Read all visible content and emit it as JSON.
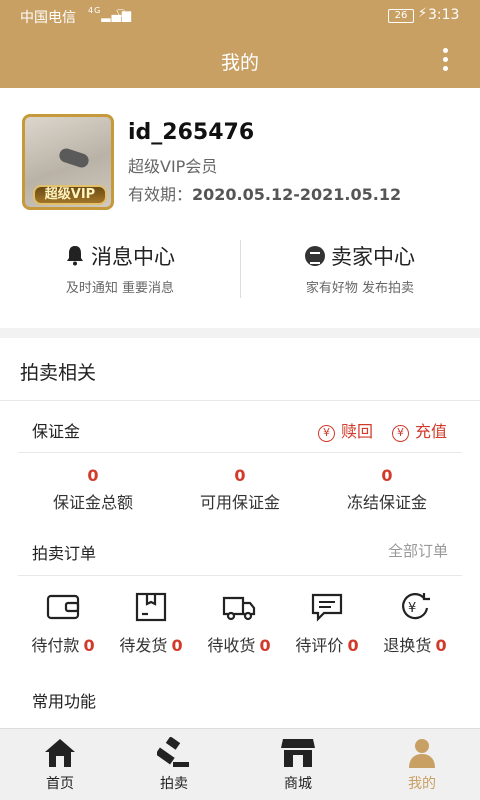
{
  "status_bar": {
    "carrier": "中国电信",
    "network": "4G",
    "battery": "26",
    "time": "3:13"
  },
  "header": {
    "title": "我的"
  },
  "profile": {
    "avatar_badge": "超级VIP",
    "user_id": "id_265476",
    "level": "超级VIP会员",
    "validity_label": "有效期：",
    "validity_value": "2020.05.12-2021.05.12"
  },
  "centers": [
    {
      "title": "消息中心",
      "subtitle": "及时通知 重要消息"
    },
    {
      "title": "卖家中心",
      "subtitle": "家有好物 发布拍卖"
    }
  ],
  "auction": {
    "section_title": "拍卖相关",
    "deposit_label": "保证金",
    "redeem_label": "赎回",
    "recharge_label": "充值",
    "stats": [
      {
        "value": "0",
        "label": "保证金总额"
      },
      {
        "value": "0",
        "label": "可用保证金"
      },
      {
        "value": "0",
        "label": "冻结保证金"
      }
    ],
    "orders_label": "拍卖订单",
    "all_orders_label": "全部订单",
    "order_states": [
      {
        "label": "待付款",
        "count": "0",
        "icon": "wallet-icon"
      },
      {
        "label": "待发货",
        "count": "0",
        "icon": "package-icon"
      },
      {
        "label": "待收货",
        "count": "0",
        "icon": "truck-icon"
      },
      {
        "label": "待评价",
        "count": "0",
        "icon": "comment-icon"
      },
      {
        "label": "退换货",
        "count": "0",
        "icon": "refund-icon"
      }
    ],
    "common_functions_label": "常用功能"
  },
  "tabbar": {
    "items": [
      {
        "label": "首页",
        "icon": "home-icon"
      },
      {
        "label": "拍卖",
        "icon": "gavel-icon"
      },
      {
        "label": "商城",
        "icon": "store-icon"
      },
      {
        "label": "我的",
        "icon": "person-icon"
      }
    ],
    "active": "我的"
  },
  "colors": {
    "header": "#c9a064",
    "accent_red": "#d23a2a",
    "gold": "#c69a3a"
  }
}
